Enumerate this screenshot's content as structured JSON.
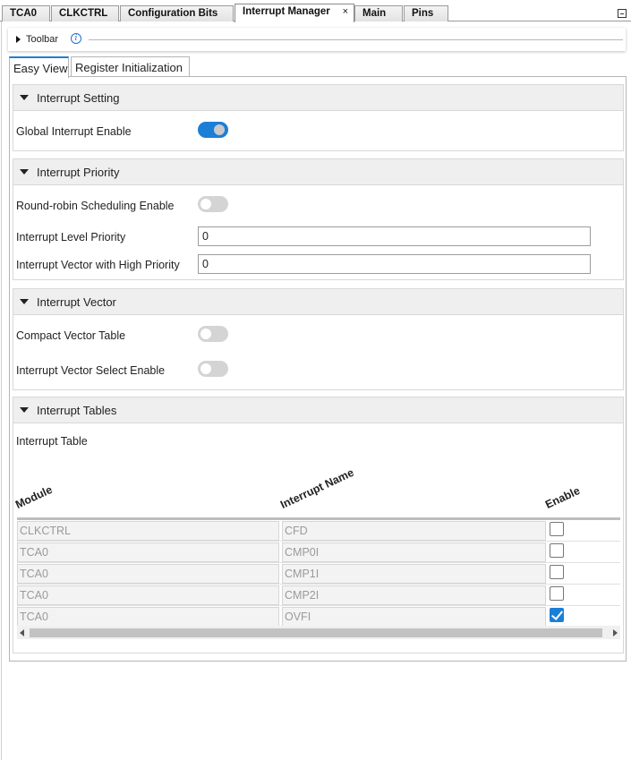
{
  "editor_tabs": [
    {
      "label": "TCA0"
    },
    {
      "label": "CLKCTRL"
    },
    {
      "label": "Configuration Bits"
    },
    {
      "label": "Interrupt Manager",
      "close": "×"
    },
    {
      "label": "Main"
    },
    {
      "label": "Pins"
    }
  ],
  "active_editor_tab": "Interrupt Manager",
  "toolbar": {
    "label": "Toolbar",
    "info_glyph": "i"
  },
  "view_tabs": [
    {
      "label": "Easy View"
    },
    {
      "label": "Register Initialization"
    }
  ],
  "active_view_tab": "Easy View",
  "sections": {
    "interrupt_setting": {
      "title": "Interrupt Setting",
      "global_enable": {
        "label": "Global Interrupt Enable",
        "value": true
      }
    },
    "interrupt_priority": {
      "title": "Interrupt Priority",
      "round_robin": {
        "label": "Round-robin Scheduling Enable",
        "value": false
      },
      "level_priority": {
        "label": "Interrupt Level Priority",
        "value": "0"
      },
      "vector_high": {
        "label": "Interrupt Vector with High Priority",
        "value": "0"
      }
    },
    "interrupt_vector": {
      "title": "Interrupt Vector",
      "compact_table": {
        "label": "Compact Vector Table",
        "value": false
      },
      "vector_select": {
        "label": "Interrupt Vector Select Enable",
        "value": false
      }
    },
    "interrupt_tables": {
      "title": "Interrupt Tables",
      "subtitle": "Interrupt Table",
      "columns": [
        "Module",
        "Interrupt Name",
        "Enable"
      ],
      "rows": [
        {
          "module": "CLKCTRL",
          "name": "CFD",
          "enabled": false
        },
        {
          "module": "TCA0",
          "name": "CMP0I",
          "enabled": false
        },
        {
          "module": "TCA0",
          "name": "CMP1I",
          "enabled": false
        },
        {
          "module": "TCA0",
          "name": "CMP2I",
          "enabled": false
        },
        {
          "module": "TCA0",
          "name": "OVFI",
          "enabled": true
        }
      ]
    }
  },
  "colors": {
    "accent": "#1b7fd6",
    "header_bg": "#efefef"
  }
}
